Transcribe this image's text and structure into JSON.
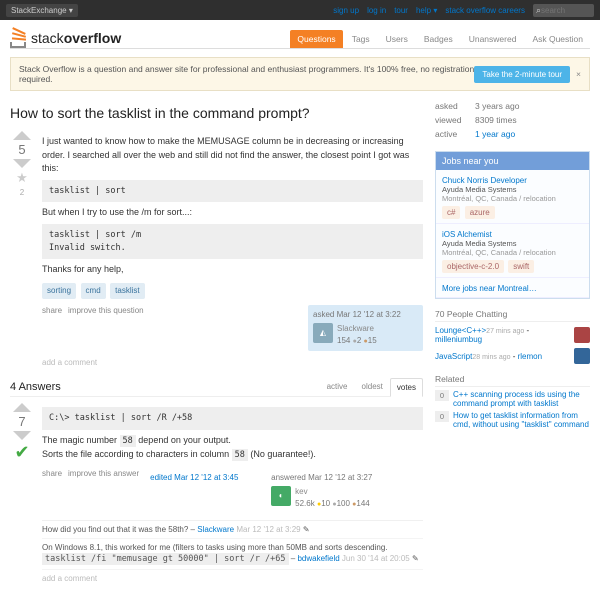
{
  "topbar": {
    "exchange": "StackExchange",
    "links": [
      "sign up",
      "log in",
      "tour",
      "help",
      "stack overflow careers"
    ],
    "search_ph": "search"
  },
  "logo": {
    "p1": "stack",
    "p2": "overflow"
  },
  "nav": [
    {
      "label": "Questions",
      "active": true
    },
    {
      "label": "Tags"
    },
    {
      "label": "Users"
    },
    {
      "label": "Badges"
    },
    {
      "label": "Unanswered"
    },
    {
      "label": "Ask Question"
    }
  ],
  "banner": {
    "msg": "Stack Overflow is a question and answer site for professional and enthusiast programmers. It's 100% free, no registration required.",
    "btn": "Take the 2-minute tour",
    "x": "×"
  },
  "title": "How to sort the tasklist in the command prompt?",
  "q": {
    "votes": "5",
    "favs": "2",
    "p1": "I just wanted to know how to make the MEMUSAGE column be in decreasing or increasing order. I searched all over the web and still did not find the answer, the closest point I got was this:",
    "c1": "tasklist | sort",
    "p2": "But when I try to use the /m for sort...:",
    "c2": "tasklist | sort /m\nInvalid switch.",
    "p3": "Thanks for any help,",
    "tags": [
      "sorting",
      "cmd",
      "tasklist"
    ],
    "actions": [
      "share",
      "improve this question"
    ],
    "sig": {
      "when": "asked Mar 12 '12 at 3:22",
      "user": "Slackware",
      "rep": "154",
      "g": "",
      "s": "2",
      "b": "15"
    },
    "addc": "add a comment"
  },
  "ans": {
    "count": "4 Answers",
    "tabs": [
      {
        "l": "active"
      },
      {
        "l": "oldest"
      },
      {
        "l": "votes",
        "active": true
      }
    ],
    "votes": "7",
    "c1": "C:\\> tasklist | sort /R /+58",
    "p1a": "The magic number ",
    "p1code": "58",
    "p1b": " depend on your output.",
    "p2a": "Sorts the file according to characters in column ",
    "p2code": "58",
    "p2b": " (No guarantee!).",
    "actions": [
      "share",
      "improve this answer"
    ],
    "edited": {
      "when": "edited Mar 12 '12 at 3:45"
    },
    "sig": {
      "when": "answered Mar 12 '12 at 3:27",
      "user": "kev",
      "rep": "52.6k",
      "g": "10",
      "s": "100",
      "b": "144"
    },
    "comments": [
      {
        "t": "How did you find out that it was the 58th? – ",
        "u": "Slackware",
        "d": "Mar 12 '12 at 3:29",
        "e": "✎"
      },
      {
        "t": "On Windows 8.1, this worked for me (filters to tasks using more than 50MB and sorts descending. ",
        "code": "tasklist /fi \"memusage gt 50000\" | sort /r /+65",
        "dash": " – ",
        "u": "bdwakefield",
        "d": "Jun 30 '14 at 20:05",
        "e": "✎"
      }
    ],
    "addc": "add a comment"
  },
  "side": {
    "info": [
      {
        "l": "asked",
        "v": "3 years ago"
      },
      {
        "l": "viewed",
        "v": "8309 times"
      },
      {
        "l": "active",
        "v": "1 year ago"
      }
    ],
    "jobs": {
      "h": "Jobs near you",
      "items": [
        {
          "t": "Chuck Norris Developer",
          "c": "Ayuda Media Systems",
          "loc": "Montréal, QC, Canada / relocation",
          "tags": [
            "c#",
            "azure"
          ]
        },
        {
          "t": "iOS Alchemist",
          "c": "Ayuda Media Systems",
          "loc": "Montréal, QC, Canada / relocation",
          "tags": [
            "objective-c-2.0",
            "swift"
          ]
        }
      ],
      "more": "More jobs near Montreal…"
    },
    "chat": {
      "h": "70 People Chatting",
      "rooms": [
        {
          "n": "Lounge<C++>",
          "ago": "27 mins ago",
          "u": "milleniumbug"
        },
        {
          "n": "JavaScript",
          "ago": "28 mins ago",
          "u": "rlemon"
        }
      ]
    },
    "related": {
      "h": "Related",
      "items": [
        {
          "n": "0",
          "t": "C++ scanning process ids using the command prompt with tasklist"
        },
        {
          "n": "0",
          "t": "How to get tasklist information from cmd, without using \"tasklist\" command"
        }
      ]
    }
  }
}
